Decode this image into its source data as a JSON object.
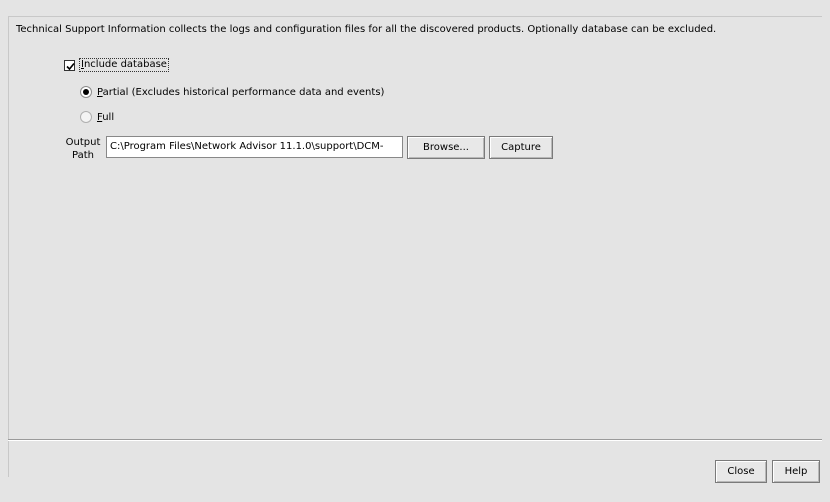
{
  "description": "Technical Support Information collects the logs and configuration files for all the discovered products. Optionally database can be excluded.",
  "include_database": {
    "label_mnemonic": "I",
    "label_rest": "nclude database",
    "checked": true
  },
  "options": {
    "partial": {
      "mnemonic": "P",
      "rest": "artial (Excludes historical performance data and events)",
      "selected": true
    },
    "full": {
      "mnemonic": "F",
      "rest": "ull",
      "selected": false
    }
  },
  "output_path": {
    "label_line1": "Output",
    "label_line2": "Path",
    "value": "C:\\Program Files\\Network Advisor 11.1.0\\support\\DCM-"
  },
  "buttons": {
    "browse": "Browse...",
    "capture": "Capture",
    "close": "Close",
    "help": "Help"
  }
}
